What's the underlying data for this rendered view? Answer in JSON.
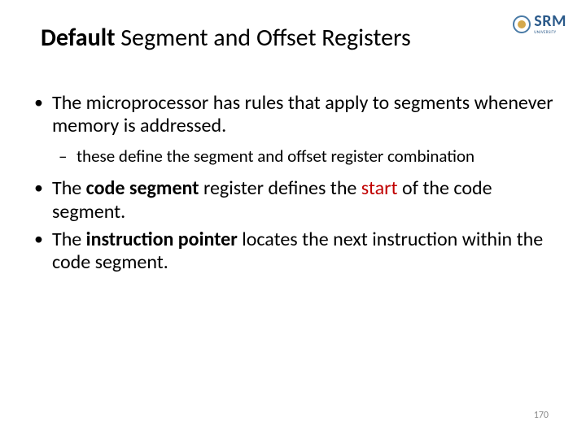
{
  "logo": {
    "text": "SRM",
    "subtitle": "UNIVERSITY"
  },
  "title": {
    "bold": "Default",
    "rest": " Segment and Offset Registers"
  },
  "bullets": {
    "b1": "The microprocessor has rules that apply to segments whenever memory is addressed.",
    "b1_sub": "these define the segment and offset register combination",
    "b2_pre": "The ",
    "b2_bold1": "code segment",
    "b2_mid1": " register defines the ",
    "b2_red": "start",
    "b2_mid2": " of the code segment.",
    "b3_pre": "The ",
    "b3_bold": "instruction pointer",
    "b3_rest": " locates the next instruction within the code segment."
  },
  "page_number": "170"
}
